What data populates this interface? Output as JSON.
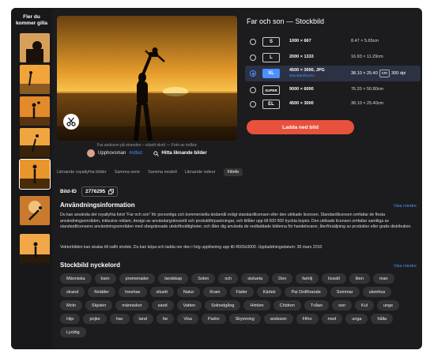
{
  "thumbs": {
    "title": "Fler du kommer gilla",
    "items": [
      "silhouette-parent-child",
      "beach-play",
      "family-sunset",
      "sunset-lift",
      "selected-current",
      "child-sky",
      "sunset-crouch"
    ]
  },
  "image": {
    "caption": "Far andsson på stranden – siluett skott — Foto av mdlsiz",
    "author_prefix": "Upphovsman",
    "author_name": "mdlsiz",
    "similar_label": "Hitta liknande bilder"
  },
  "panel": {
    "title": "Far och son — Stockbild",
    "sizes": [
      {
        "label": "S",
        "dims": "1000 × 667",
        "sub": "",
        "cm": "8.47 × 5.65cm",
        "selected": false
      },
      {
        "label": "L",
        "dims": "2000 × 1333",
        "sub": "",
        "cm": "16.93 × 11.29cm",
        "selected": false
      },
      {
        "label": "XL",
        "dims": "4500 × 3000, JPG",
        "sub": "Standardlicens",
        "cm": "38.10 × 25.40",
        "unit": "cm",
        "dpi": "300 dpi",
        "selected": true
      },
      {
        "label": "SUPER",
        "dims": "9000 × 6000",
        "sub": "",
        "cm": "76.20 × 50.80cm",
        "selected": false
      },
      {
        "label": "EL",
        "dims": "4500 × 3000",
        "sub": "",
        "cm": "38.10 × 25.40cm",
        "selected": false
      }
    ],
    "download_label": "Ladda ned bild"
  },
  "tabs": [
    "Liknande royaltyfria bilder",
    "Samma serie",
    "Samma modell",
    "Liknande videor",
    "Filinfo"
  ],
  "bild_id": {
    "label": "Bild-ID",
    "value": "2776295"
  },
  "usage": {
    "title": "Användningsinformation",
    "toggle": "Visa mindre",
    "p1": "Du kan använda det royaltyfria fotot \"Far och son\" för personliga och kommersiella ändamål enligt standardlicensen eller den utökade licensen. Standardlicensen omfattar de flesta användningsområden, inklusive reklam, design av användargränssnitt och produktförpackningar, och tillåter upp till 500 000 tryckta kopior. Den utökade licensen omfattar samtliga av standardlicensens användningsområden med obegränsade utskriftsrättigheter, och låter dig använda de nedladdade bilderna för handelsvaror, återförsäljning av produkter eller gratis distribution.",
    "p2": "Vektorbilden kan skalas till valfri storlek. Du kan köpa och ladda ner den i hög upplösning upp till 4500x3000. Uppladdningsdatum: 30 mars 2010"
  },
  "keywords": {
    "title": "Stockbild nyckelord",
    "toggle": "Visa mindre",
    "items": [
      "Människa",
      "barn",
      "promenader",
      "landskap",
      "Solen",
      "och",
      "siolueta",
      "Den",
      "familj",
      "livsstil",
      "liten",
      "man",
      "strand",
      "förälder",
      "Innehav",
      "siluett",
      "Natur",
      "Kram",
      "Fäder",
      "Kärlek",
      "Pai Ordförande",
      "Sommar",
      "ulomhus",
      "Moln",
      "Skjuten",
      "människor",
      "sand",
      "Vatten",
      "Solnedgång",
      "Himlen",
      "Chidren",
      "Tvåan",
      "son",
      "Kul",
      "unge",
      "Hijo",
      "pojke",
      "hav",
      "land",
      "far",
      "Visa",
      "Padre",
      "Skymning",
      "andsson",
      "Filho",
      "med",
      "unga",
      "hålla",
      "Lycklig"
    ]
  }
}
